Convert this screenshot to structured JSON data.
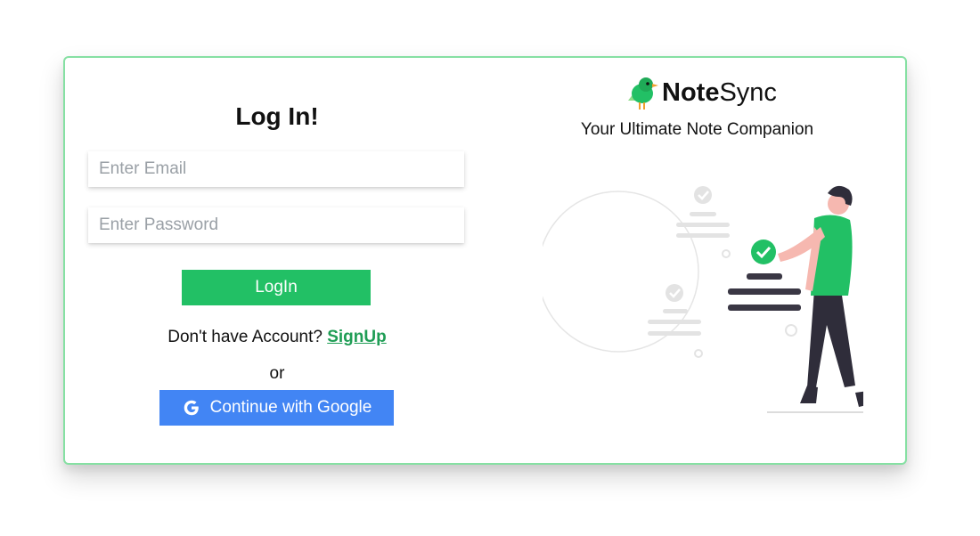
{
  "login": {
    "title": "Log In!",
    "email_placeholder": "Enter Email",
    "password_placeholder": "Enter Password",
    "login_button": "LogIn",
    "signup_prompt": "Don't have Account?",
    "signup_link": "SignUp",
    "or_text": "or",
    "google_button": "Continue with Google"
  },
  "brand": {
    "name_bold": "Note",
    "name_regular": "Sync",
    "tagline": "Your Ultimate Note Companion",
    "logo_icon": "bird-icon"
  },
  "colors": {
    "accent_green": "#22c065",
    "border_green": "#86e0a3",
    "link_green": "#1f9d55",
    "google_blue": "#4285f4"
  }
}
